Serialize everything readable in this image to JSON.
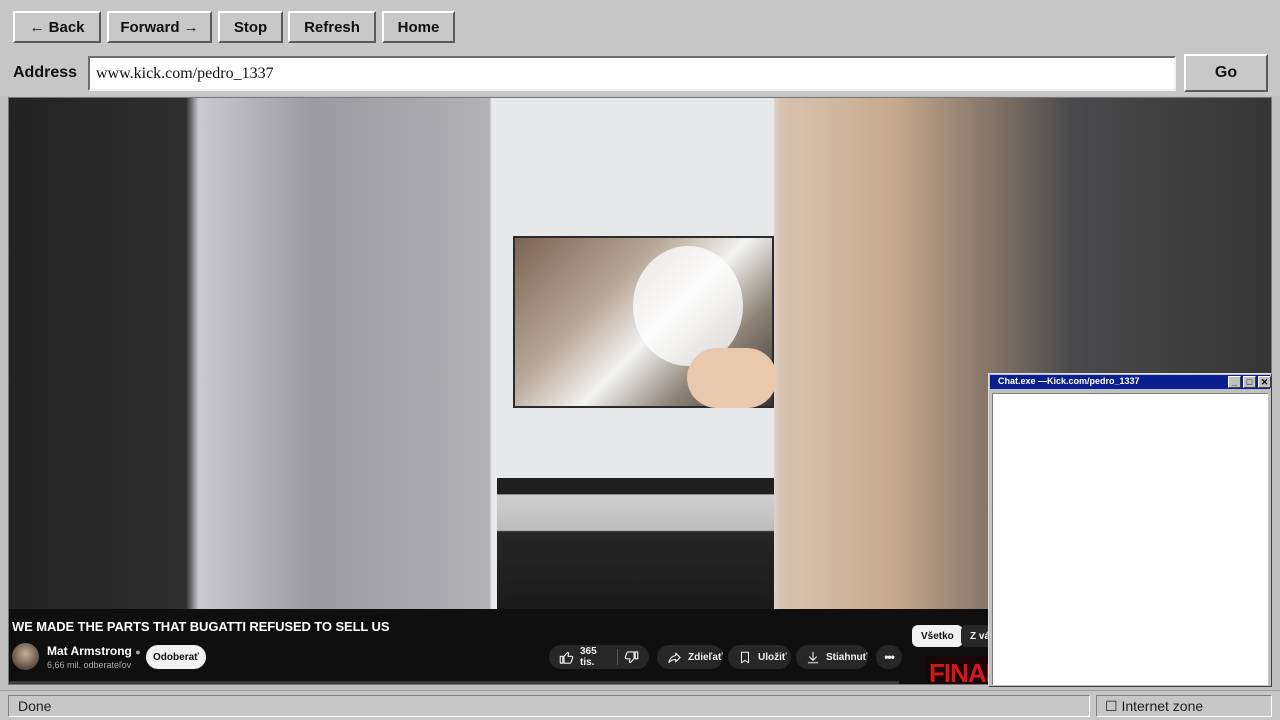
{
  "toolbar": {
    "back_label": "← Back",
    "forward_label": "Forward →",
    "stop_label": "Stop",
    "refresh_label": "Refresh",
    "home_label": "Home"
  },
  "address": {
    "label": "Address",
    "url": "www.kick.com/pedro_1337",
    "go_label": "Go"
  },
  "video": {
    "title": "WE MADE THE PARTS THAT BUGATTI REFUSED TO SELL US",
    "channel": "Mat Armstrong",
    "subscribers": "6,66 mil. odberateľov",
    "subscribe_label": "Odoberať",
    "likes": "365 tis.",
    "share_label": "Zdieľať",
    "save_label": "Uložiť",
    "download_label": "Stiahnuť",
    "chip_all": "Všetko",
    "chip_next": "Z vá",
    "thumb_text": "FINAL"
  },
  "chat": {
    "title": "Chat.exe —Kick.com/pedro_1337",
    "min": "_",
    "max": "□",
    "close": "✕"
  },
  "status": {
    "text": "Done",
    "zone": "☐ Internet zone"
  }
}
